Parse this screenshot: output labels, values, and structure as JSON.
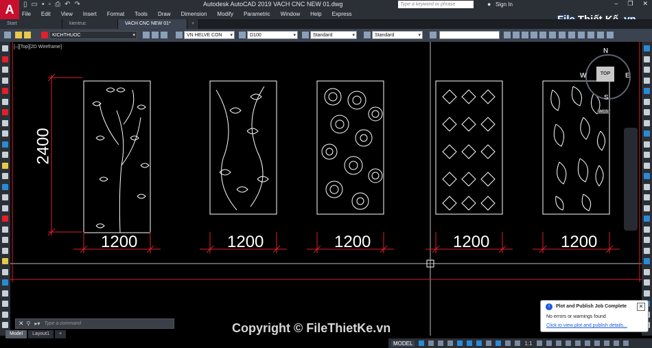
{
  "app": {
    "logo": "A",
    "title": "Autodesk AutoCAD 2019    VACH CNC NEW 01.dwg",
    "search_placeholder": "Type a keyword or phrase",
    "sign_in": "Sign In"
  },
  "brand": {
    "part1": "File",
    "part2": "Thiết Kế",
    "part3": ".vn"
  },
  "menu": [
    "File",
    "Edit",
    "View",
    "Insert",
    "Format",
    "Tools",
    "Draw",
    "Dimension",
    "Modify",
    "Parametric",
    "Window",
    "Help",
    "Express"
  ],
  "tabs": [
    {
      "label": "Start"
    },
    {
      "label": "kientruc 12.2.2020*"
    },
    {
      "label": "VACH CNC NEW 01*"
    },
    {
      "label": "+"
    }
  ],
  "properties": {
    "layer": "KICHTHUOC",
    "text_style": "VN HELVE CON",
    "dim_style": "D100",
    "table_style": "Standard",
    "multileader_style": "Standard"
  },
  "viewport": {
    "label": "[–][Top][2D Wireframe]",
    "vertical_dim": "2400",
    "horizontal_dims": [
      "1200",
      "1200",
      "1200",
      "1200",
      "1200"
    ]
  },
  "viewcube": {
    "north": "N",
    "south": "S",
    "east": "E",
    "west": "W",
    "face": "TOP",
    "wcs": "WCS"
  },
  "command": {
    "close": "✕",
    "placeholder": "Type a command"
  },
  "layout_tabs": [
    "Model",
    "Layout1",
    "+"
  ],
  "status": {
    "model": "MODEL",
    "scale": "1:1"
  },
  "watermark": "Copyright © FileThietKe.vn",
  "notification": {
    "title": "Plot and Publish Job Complete",
    "message": "No errors or warnings found",
    "link": "Click to view plot and publish details..."
  },
  "colors": {
    "dim_red": "#e0202a",
    "panel_white": "#ffffff",
    "accent_blue": "#2a8ad6"
  }
}
